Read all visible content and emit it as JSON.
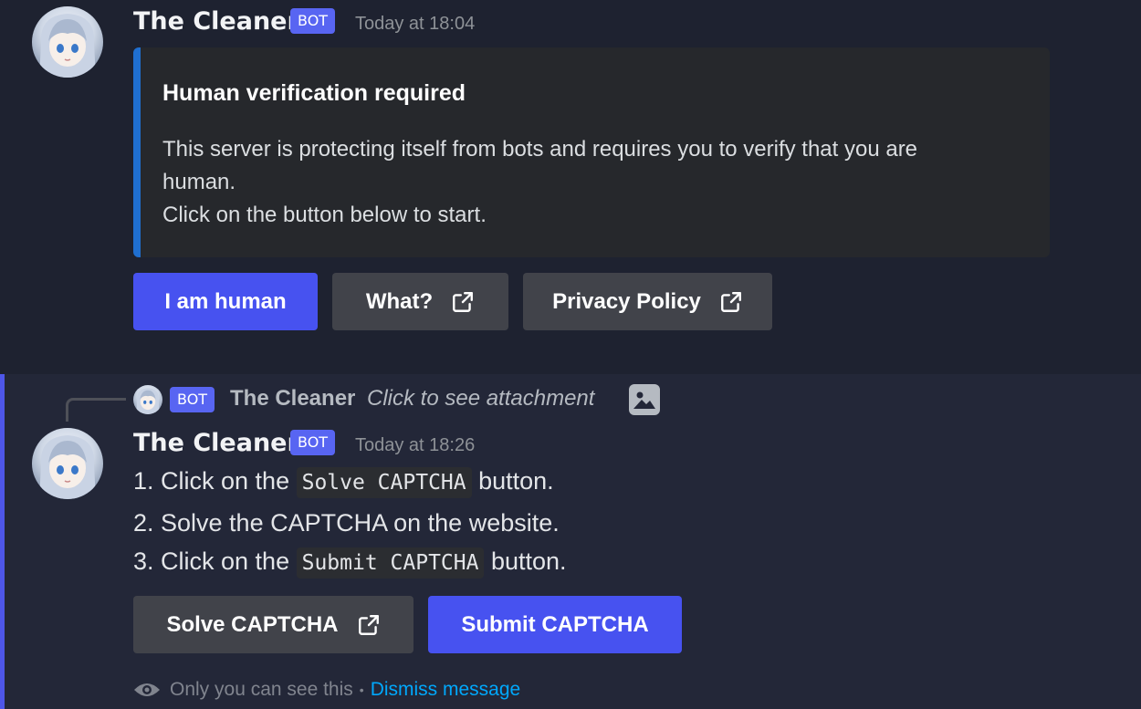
{
  "colors": {
    "background": "#1e2230",
    "embed_accent": "#1f6fd0",
    "primary_button": "#4752f0",
    "secondary_button": "#41434a",
    "bot_badge": "#5865f2",
    "link": "#00a8fc"
  },
  "message1": {
    "author": "The Cleaner",
    "badge": "BOT",
    "timestamp": "Today at 18:04",
    "avatar_icon": "anime-character-avatar",
    "embed": {
      "title": "Human verification required",
      "description_lines": [
        "This server is protecting itself from bots and requires you to verify that you are",
        "human.",
        "Click on the button below to start."
      ]
    },
    "buttons": [
      {
        "label": "I am human",
        "style": "primary",
        "icon": ""
      },
      {
        "label": "What?",
        "style": "secondary",
        "icon": "external-link-icon"
      },
      {
        "label": "Privacy Policy",
        "style": "secondary",
        "icon": "external-link-icon"
      }
    ]
  },
  "message2": {
    "reply": {
      "badge": "BOT",
      "author": "The Cleaner",
      "text": "Click to see attachment",
      "icon": "image-icon"
    },
    "author": "The Cleaner",
    "badge": "BOT",
    "timestamp": "Today at 18:26",
    "lines": [
      {
        "before": "1. Click on the ",
        "code": "Solve CAPTCHA",
        "after": " button."
      },
      {
        "before": "2. Solve the CAPTCHA on the website.",
        "code": "",
        "after": ""
      },
      {
        "before": "3. Click on the ",
        "code": "Submit CAPTCHA",
        "after": " button."
      }
    ],
    "buttons": [
      {
        "label": "Solve CAPTCHA",
        "style": "secondary",
        "icon": "external-link-icon"
      },
      {
        "label": "Submit CAPTCHA",
        "style": "primary",
        "icon": ""
      }
    ],
    "footer": {
      "notice": "Only you can see this",
      "separator": "•",
      "dismiss": "Dismiss message",
      "icon": "eye-icon"
    }
  }
}
